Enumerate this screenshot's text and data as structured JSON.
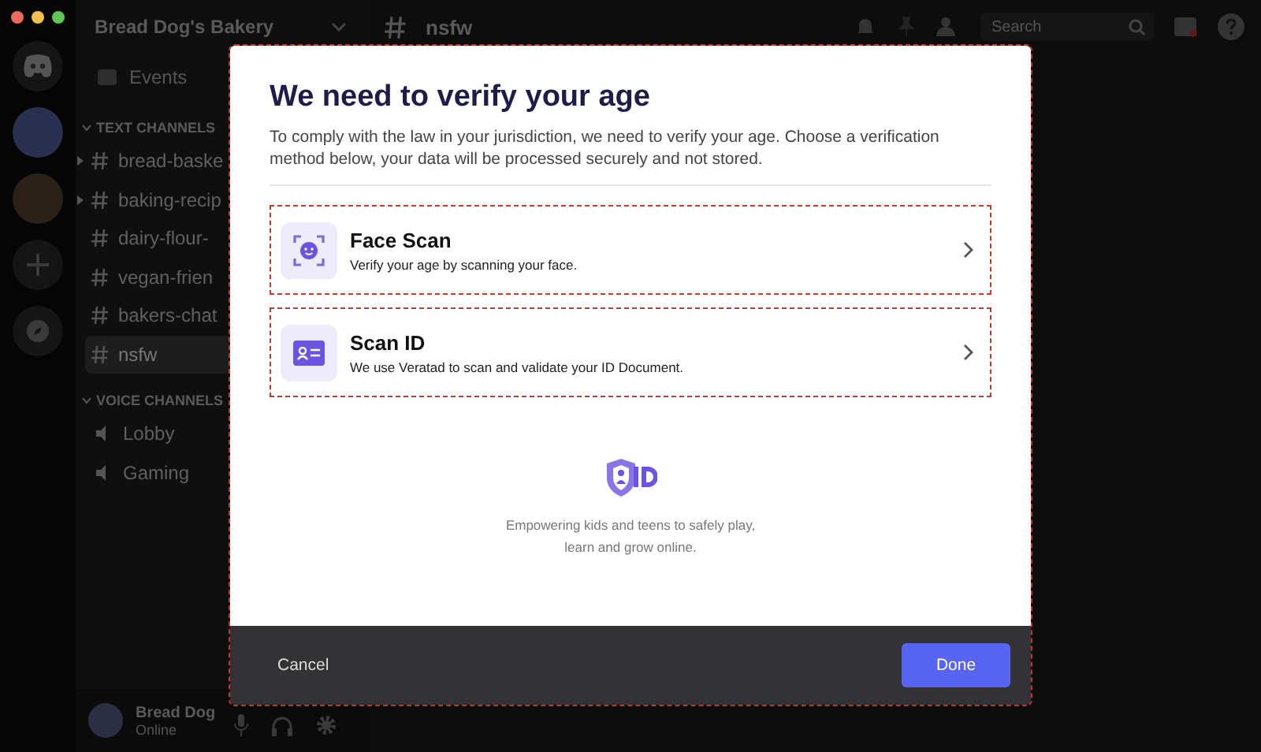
{
  "server": {
    "name": "Bread Dog's Bakery"
  },
  "sidebar": {
    "events_label": "Events",
    "text_header": "TEXT CHANNELS",
    "text_channels": [
      {
        "name": "bread-baske",
        "selected": false,
        "has_arrow": true
      },
      {
        "name": "baking-recip",
        "selected": false,
        "has_arrow": true
      },
      {
        "name": "dairy-flour-",
        "selected": false,
        "has_arrow": false
      },
      {
        "name": "vegan-frien",
        "selected": false,
        "has_arrow": false
      },
      {
        "name": "bakers-chat",
        "selected": false,
        "has_arrow": false
      },
      {
        "name": "nsfw",
        "selected": true,
        "has_arrow": false
      }
    ],
    "voice_header": "VOICE CHANNELS",
    "voice_channels": [
      {
        "name": "Lobby"
      },
      {
        "name": "Gaming"
      }
    ]
  },
  "user": {
    "name": "Bread Dog",
    "status": "Online"
  },
  "topbar": {
    "channel": "nsfw",
    "search_placeholder": "Search"
  },
  "modal": {
    "title": "We need to verify your age",
    "description": "To comply with the law in your jurisdiction, we need to verify your age. Choose a verification method below, your data will be processed securely and not stored.",
    "options": [
      {
        "kind": "face",
        "title": "Face Scan",
        "subtitle": "Verify your age by scanning your face."
      },
      {
        "kind": "id",
        "title": "Scan ID",
        "subtitle": "We use Veratad to scan and validate your ID Document."
      }
    ],
    "tagline": "Empowering kids and teens to safely play, learn and grow online.",
    "cancel": "Cancel",
    "done": "Done"
  }
}
